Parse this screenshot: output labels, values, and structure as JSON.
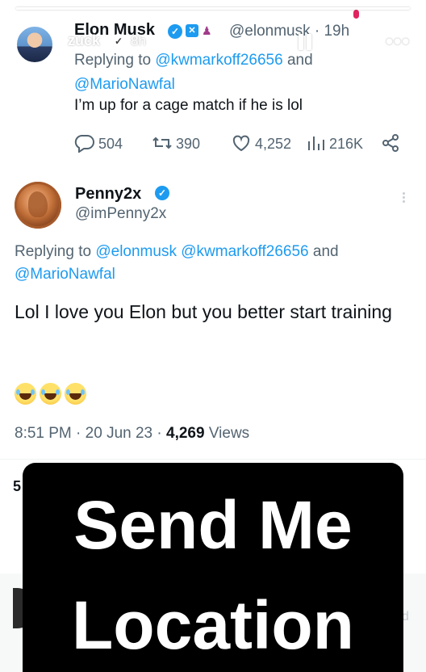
{
  "story": {
    "progress_fraction": 0.96,
    "username": "zuck",
    "time_ago": "8h",
    "colors": {
      "overlay_bg": "#000000",
      "overlay_text": "#ffffff"
    }
  },
  "tweet1": {
    "display_name": "Elon Musk",
    "handle_time": "@elonmusk · 19h",
    "replying_prefix": "Replying to",
    "reply_mention_1": "@kwmarkoff26656",
    "reply_and": "and",
    "reply_mention_2": "@MarioNawfal",
    "text": "I’m up for a cage match if he is lol",
    "replies": "504",
    "retweets": "390",
    "likes": "4,252",
    "views": "216K",
    "icons": [
      "reply-icon",
      "retweet-icon",
      "like-icon",
      "views-icon",
      "share-icon"
    ]
  },
  "tweet2": {
    "display_name": "Penny2x",
    "handle": "@imPenny2x",
    "replying_prefix": "Replying to",
    "reply_mention_1": "@elonmusk",
    "reply_mention_2": "@kwmarkoff26656",
    "reply_and": "and",
    "reply_mention_3": "@MarioNawfal",
    "text": "Lol I love you Elon but you better start training",
    "time": "8:51 PM",
    "date": "20 Jun 23",
    "views_count": "4,269",
    "views_label": "Views",
    "peek_number": "5"
  },
  "overlay": {
    "line1": "Send Me",
    "line2": "Location"
  },
  "colors": {
    "link": "#1d9bf0",
    "muted": "#536471",
    "text": "#0f1419"
  }
}
